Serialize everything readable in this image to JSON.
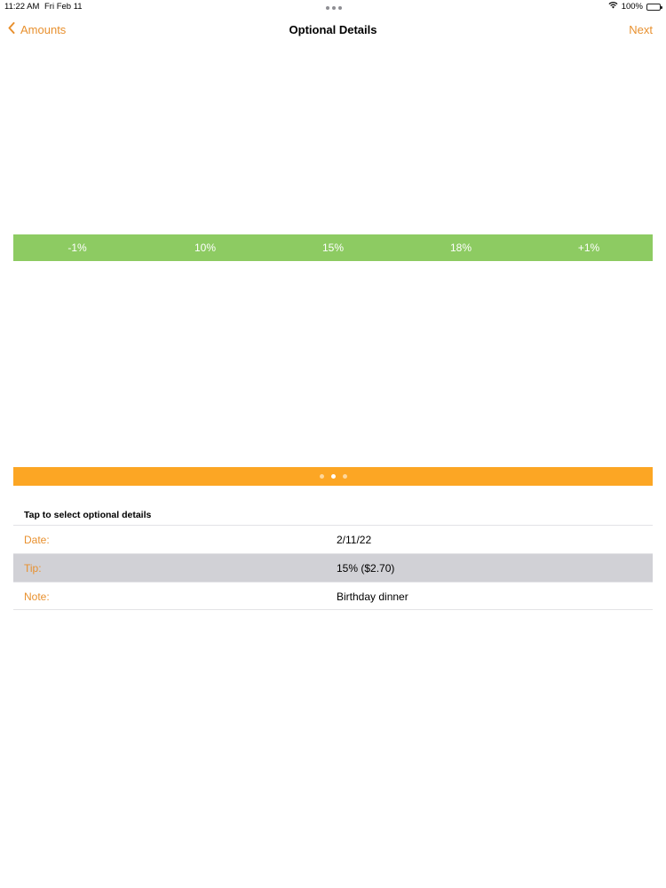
{
  "status_bar": {
    "time": "11:22 AM",
    "date": "Fri Feb 11",
    "battery": "100%",
    "icons": [
      "wifi-icon",
      "battery-icon"
    ]
  },
  "nav": {
    "back_label": "Amounts",
    "title": "Optional Details",
    "next_label": "Next"
  },
  "tip_picker": {
    "options": [
      "-1%",
      "10%",
      "15%",
      "18%",
      "+1%"
    ]
  },
  "page_control": {
    "pages": 3,
    "current_page": 2
  },
  "details": {
    "header": "Tap to select optional details",
    "rows": [
      {
        "label": "Date:",
        "value": "2/11/22",
        "selected": false
      },
      {
        "label": "Tip:",
        "value": "15% ($2.70)",
        "selected": true
      },
      {
        "label": "Note:",
        "value": "Birthday dinner",
        "selected": false
      }
    ]
  },
  "colors": {
    "accent": "#e8902e",
    "tip_bar": "#8dcb62",
    "page_bar": "#fca624",
    "selected_row": "#d1d1d6"
  }
}
